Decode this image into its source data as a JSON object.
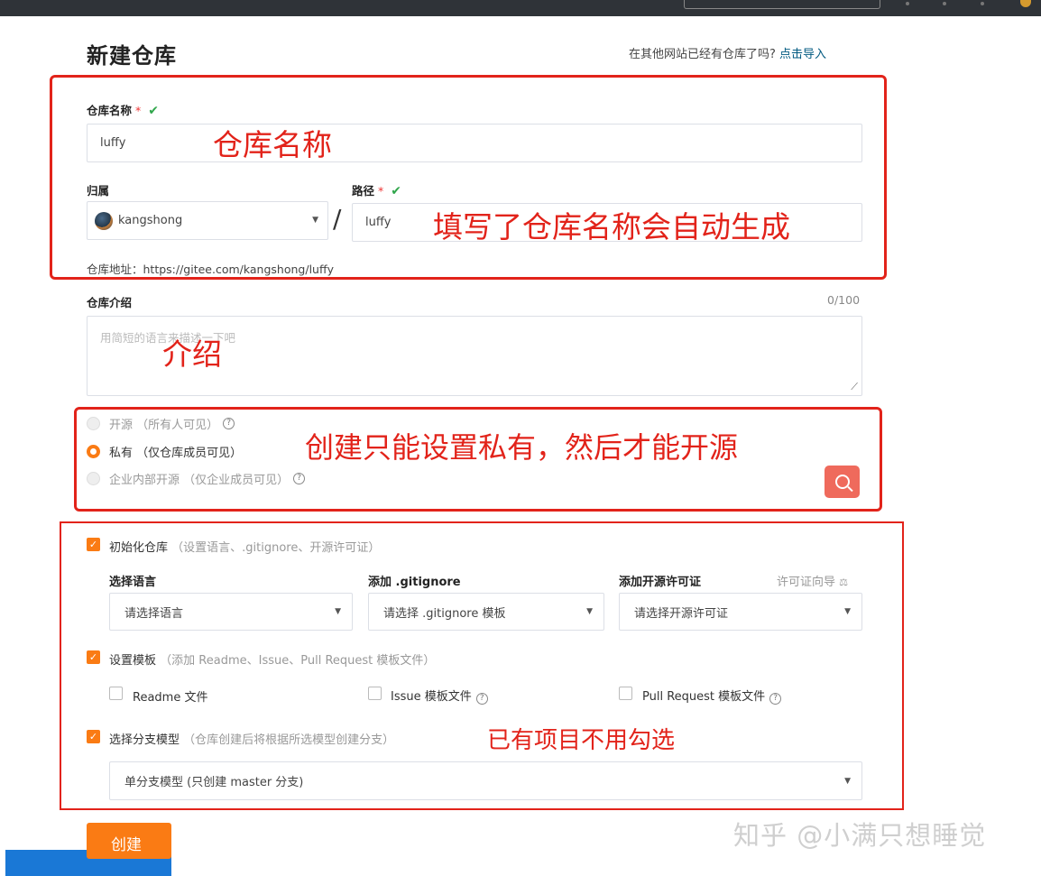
{
  "header": {
    "title": "新建仓库",
    "import_prompt": "在其他网站已经有仓库了吗?",
    "import_link": "点击导入"
  },
  "repo_name": {
    "label": "仓库名称",
    "required_mark": "*",
    "value": "luffy"
  },
  "owner": {
    "label": "归属",
    "value": "kangshong"
  },
  "path": {
    "label": "路径",
    "required_mark": "*",
    "separator": "/",
    "value": "luffy"
  },
  "repo_url": "仓库地址：https://gitee.com/kangshong/luffy",
  "intro": {
    "label": "仓库介绍",
    "counter": "0/100",
    "placeholder": "用简短的语言来描述一下吧"
  },
  "visibility": {
    "options": [
      {
        "label": "开源 （所有人可见）",
        "selected": false,
        "disabled": true,
        "help": true
      },
      {
        "label": "私有 （仅仓库成员可见）",
        "selected": true,
        "disabled": false,
        "help": false
      },
      {
        "label": "企业内部开源 （仅企业成员可见）",
        "selected": false,
        "disabled": true,
        "help": true
      }
    ]
  },
  "init": {
    "checkbox_label": "初始化仓库",
    "hint": "（设置语言、.gitignore、开源许可证）",
    "checked": true,
    "language_label": "选择语言",
    "language_placeholder": "请选择语言",
    "gitignore_label": "添加 .gitignore",
    "gitignore_placeholder": "请选择 .gitignore 模板",
    "license_label": "添加开源许可证",
    "license_guide": "许可证向导",
    "license_placeholder": "请选择开源许可证"
  },
  "template": {
    "checkbox_label": "设置模板",
    "hint": "（添加 Readme、Issue、Pull Request 模板文件）",
    "checked": true,
    "readme": "Readme 文件",
    "issue": "Issue 模板文件",
    "pull_request": "Pull Request 模板文件"
  },
  "branch": {
    "checkbox_label": "选择分支模型",
    "hint": "（仓库创建后将根据所选模型创建分支）",
    "checked": true,
    "value": "单分支模型 (只创建 master 分支)"
  },
  "create_button": "创建",
  "annotations": {
    "name": "仓库名称",
    "path": "填写了仓库名称会自动生成",
    "intro": "介绍",
    "visibility": "创建只能设置私有，然后才能开源",
    "init": "已有项目不用勾选"
  },
  "watermark": "知乎 @小满只想睡觉",
  "colors": {
    "accent": "#fa7b14",
    "annotation_red": "#e2231a",
    "valid_green": "#30a64b",
    "link_blue": "#005980"
  }
}
